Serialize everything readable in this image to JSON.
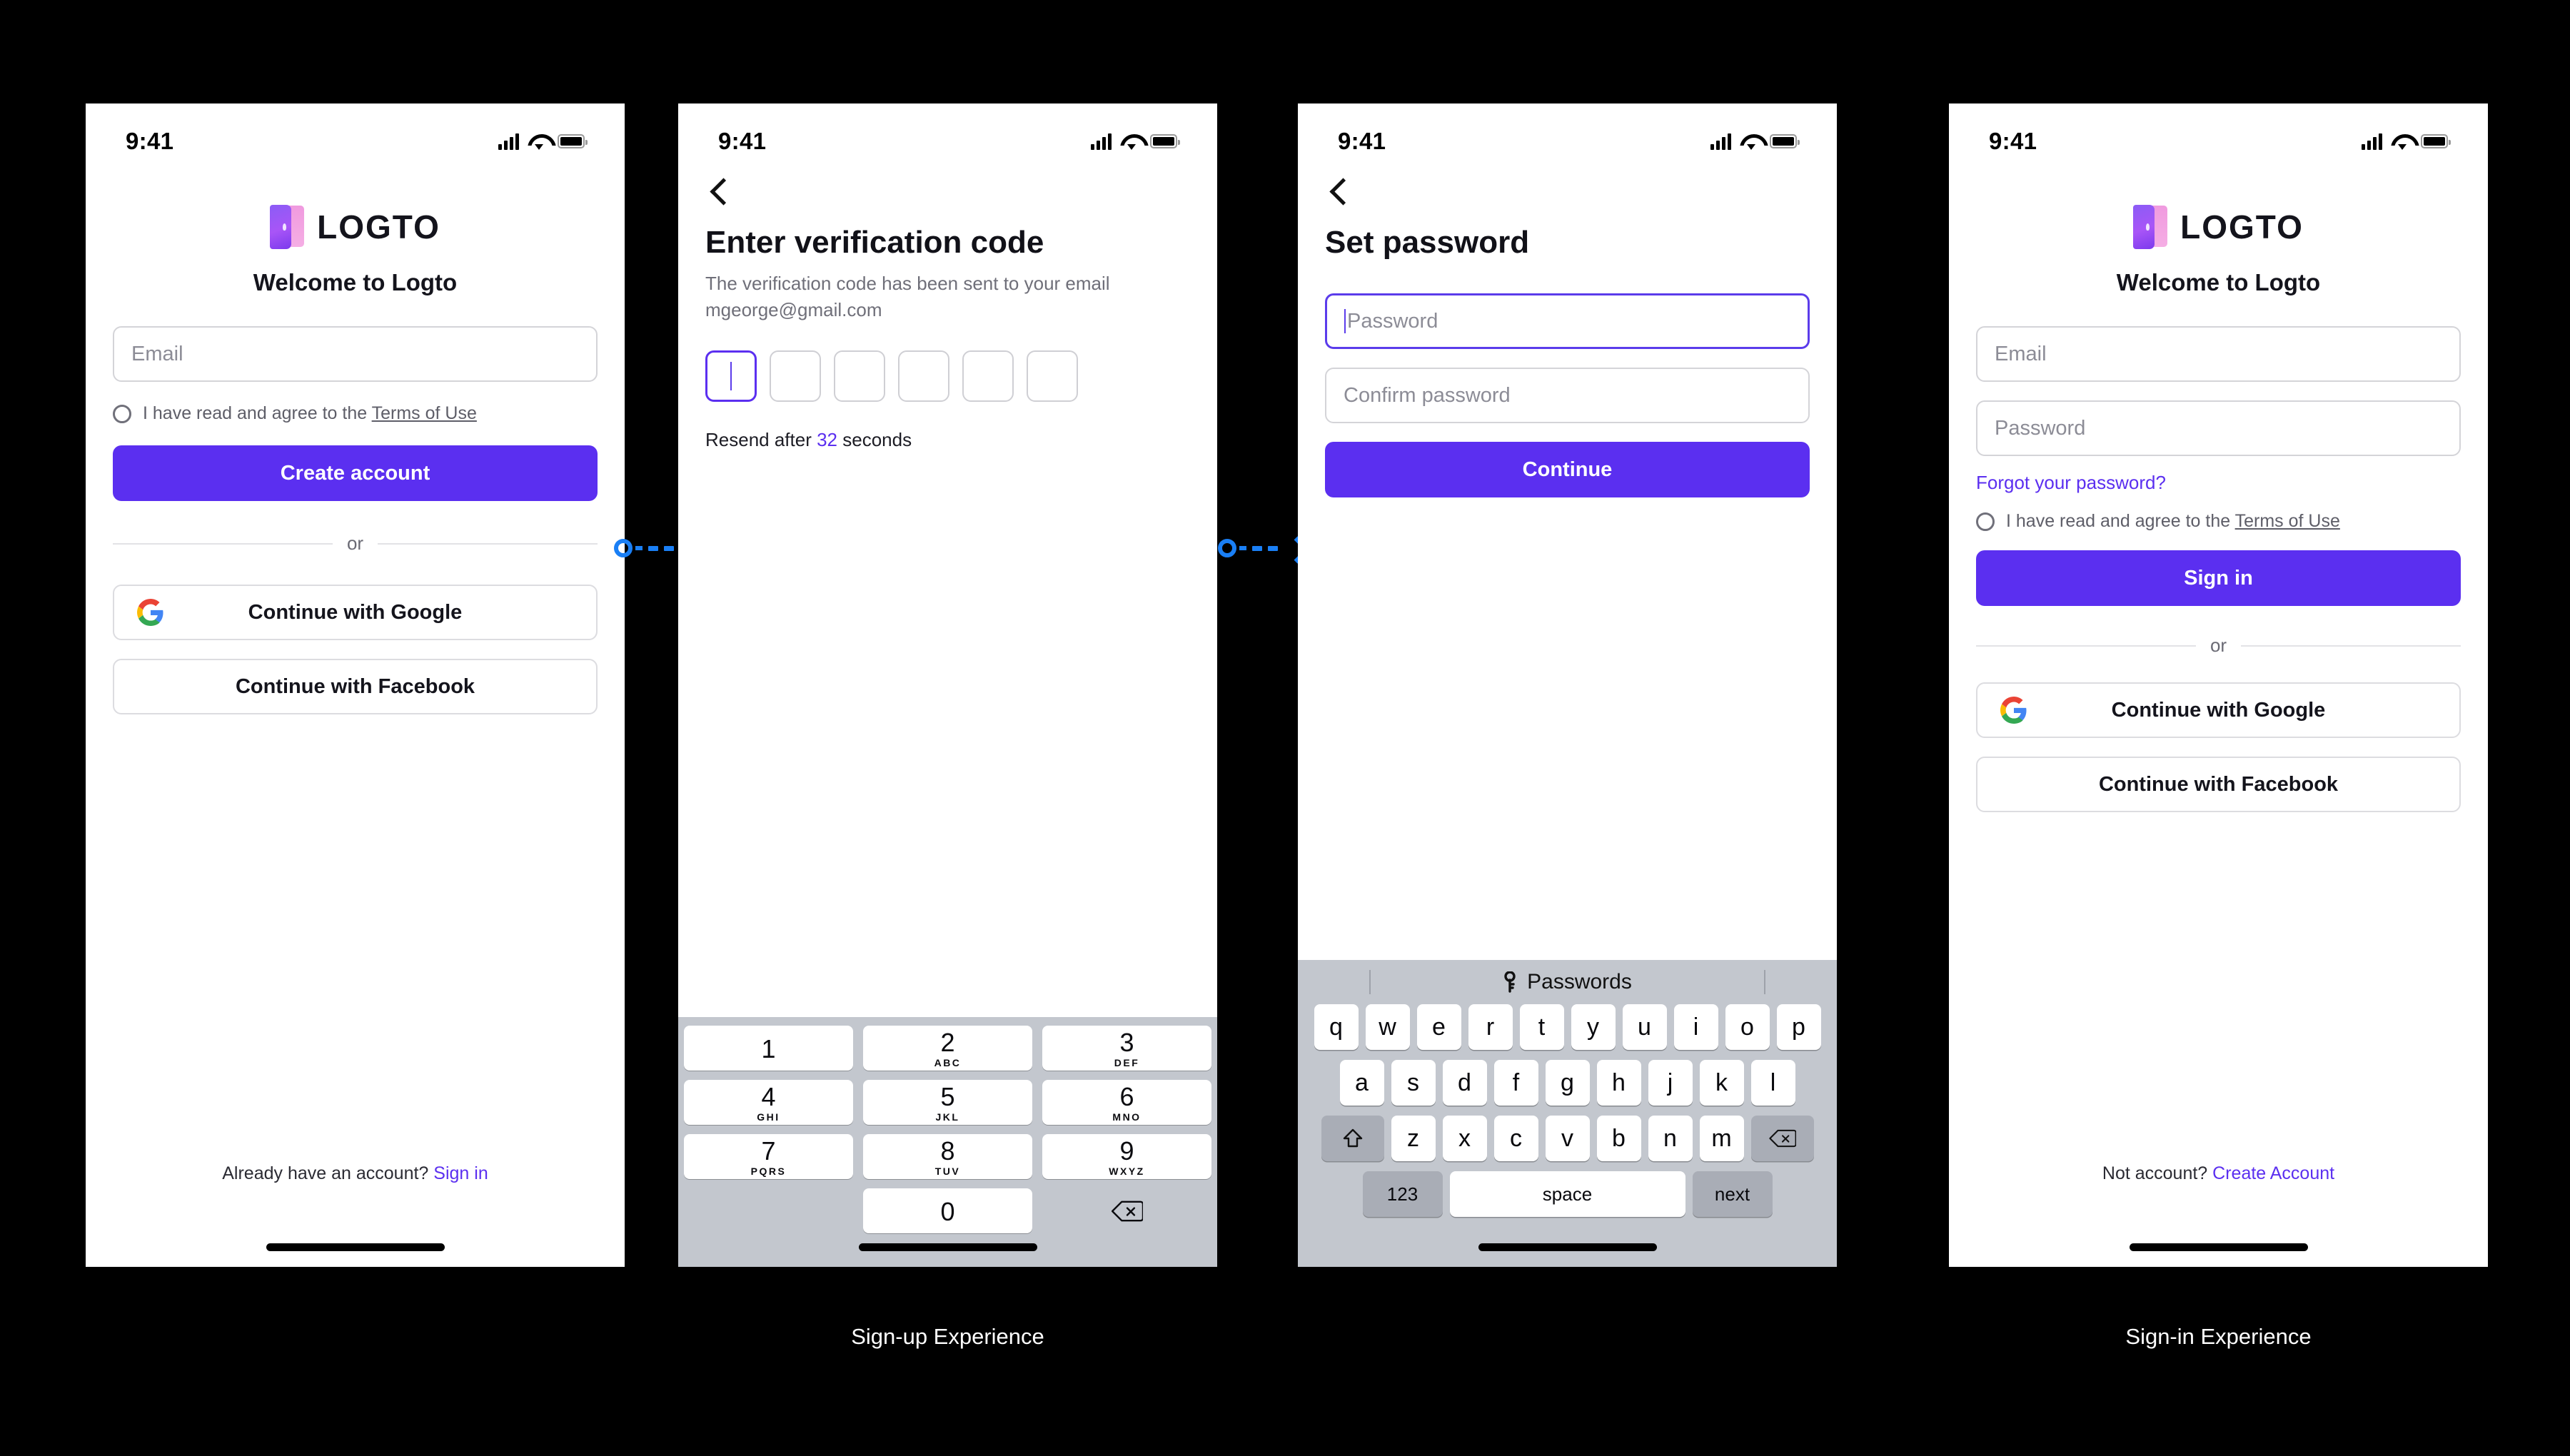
{
  "colors": {
    "brand_purple": "#5b2ff0",
    "link_purple": "#5b2ff0",
    "connector_blue": "#1a7ff5",
    "keyboard_gray": "#c3c7ce",
    "page_background": "#000000"
  },
  "status_bar": {
    "time": "9:41",
    "signal_icon": "cellular-signal-icon",
    "wifi_icon": "wifi-icon",
    "battery_icon": "battery-icon"
  },
  "screens": [
    {
      "id": "sign-up",
      "brand": {
        "logo_icon": "logto-logo-icon",
        "wordmark": "LOGTO"
      },
      "heading": "Welcome to Logto",
      "email_field": {
        "placeholder": "Email",
        "value": ""
      },
      "terms": {
        "checkbox_icon": "terms-checkbox-icon",
        "checked": false,
        "prefix": "I have read and agree to the ",
        "link": "Terms of Use"
      },
      "primary_button": "Create account",
      "divider_label": "or",
      "social": [
        {
          "icon": "google-icon",
          "label": "Continue with Google"
        },
        {
          "icon": "facebook-icon",
          "label": "Continue with Facebook"
        }
      ],
      "footer": {
        "text": "Already have an account? ",
        "link": "Sign in"
      }
    },
    {
      "id": "verification-code",
      "back_icon": "back-chevron-icon",
      "title": "Enter verification code",
      "subtitle": "The verification code has been sent to your email mgeorge@gmail.com",
      "otp": {
        "length": 6,
        "values": [
          "",
          "",
          "",
          "",
          "",
          ""
        ],
        "active_index": 0
      },
      "resend": {
        "prefix": "Resend after ",
        "seconds": "32",
        "suffix": " seconds"
      },
      "keypad": {
        "type": "numeric",
        "keys": [
          {
            "digit": "1",
            "letters": ""
          },
          {
            "digit": "2",
            "letters": "ABC"
          },
          {
            "digit": "3",
            "letters": "DEF"
          },
          {
            "digit": "4",
            "letters": "GHI"
          },
          {
            "digit": "5",
            "letters": "JKL"
          },
          {
            "digit": "6",
            "letters": "MNO"
          },
          {
            "digit": "7",
            "letters": "PQRS"
          },
          {
            "digit": "8",
            "letters": "TUV"
          },
          {
            "digit": "9",
            "letters": "WXYZ"
          },
          {
            "digit": "0",
            "letters": ""
          }
        ],
        "delete_icon": "backspace-icon"
      }
    },
    {
      "id": "set-password",
      "back_icon": "back-chevron-icon",
      "title": "Set password",
      "password_field": {
        "placeholder": "Password",
        "value": "",
        "focused": true
      },
      "confirm_field": {
        "placeholder": "Confirm password",
        "value": ""
      },
      "primary_button": "Continue",
      "keyboard": {
        "type": "qwerty",
        "suggestion_bar": {
          "icon": "key-icon",
          "label": "Passwords"
        },
        "row1": [
          "q",
          "w",
          "e",
          "r",
          "t",
          "y",
          "u",
          "i",
          "o",
          "p"
        ],
        "row2": [
          "a",
          "s",
          "d",
          "f",
          "g",
          "h",
          "j",
          "k",
          "l"
        ],
        "row3": [
          "z",
          "x",
          "c",
          "v",
          "b",
          "n",
          "m"
        ],
        "shift_icon": "shift-icon",
        "backspace_icon": "backspace-icon",
        "numbers_key": "123",
        "space_key": "space",
        "return_key": "next"
      }
    },
    {
      "id": "sign-in",
      "brand": {
        "logo_icon": "logto-logo-icon",
        "wordmark": "LOGTO"
      },
      "heading": "Welcome to Logto",
      "email_field": {
        "placeholder": "Email",
        "value": ""
      },
      "password_field": {
        "placeholder": "Password",
        "value": ""
      },
      "forgot_link": "Forgot your password?",
      "terms": {
        "checkbox_icon": "terms-checkbox-icon",
        "checked": false,
        "prefix": "I have read and agree to the ",
        "link": "Terms of Use"
      },
      "primary_button": "Sign in",
      "divider_label": "or",
      "social": [
        {
          "icon": "google-icon",
          "label": "Continue with Google"
        },
        {
          "icon": "facebook-icon",
          "label": "Continue with Facebook"
        }
      ],
      "footer": {
        "text": "Not account? ",
        "link": "Create Account"
      }
    }
  ],
  "captions": {
    "signup": "Sign-up Experience",
    "signin": "Sign-in Experience"
  }
}
